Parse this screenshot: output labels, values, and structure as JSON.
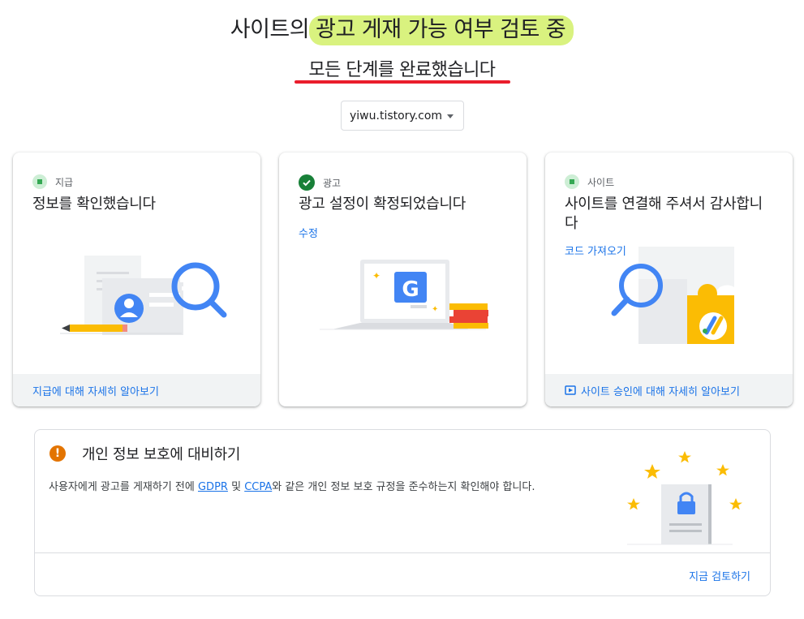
{
  "header": {
    "title_prefix": "사이트의",
    "title_highlight": "광고 게재 가능 여부 검토 중",
    "subtitle": "모든 단계를 완료했습니다"
  },
  "site_select": {
    "value": "yiwu.tistory.com"
  },
  "cards": [
    {
      "step_label": "지급",
      "heading": "정보를 확인했습니다",
      "footer_link": "지급에 대해 자세히 알아보기"
    },
    {
      "step_label": "광고",
      "heading": "광고 설정이 확정되었습니다",
      "action_link": "수정",
      "footer_link": ""
    },
    {
      "step_label": "사이트",
      "heading": "사이트를 연결해 주셔서 감사합니다",
      "action_link": "코드 가져오기",
      "footer_link": "사이트 승인에 대해 자세히 알아보기"
    }
  ],
  "privacy": {
    "title": "개인 정보 보호에 대비하기",
    "desc_before": "사용자에게 광고를 게재하기 전에 ",
    "gdpr": "GDPR",
    "desc_and": " 및 ",
    "ccpa": "CCPA",
    "desc_after": "와 같은 개인 정보 보호 규정을 준수하는지 확인해야 합니다.",
    "review_link": "지금 검토하기"
  },
  "icons": {
    "warning": "!",
    "google_g": "G"
  },
  "colors": {
    "accent_blue": "#1a73e8",
    "highlight": "#d9f27f",
    "underline_red": "#ea1d2c",
    "success_green": "#188038",
    "warning_orange": "#e37400"
  }
}
